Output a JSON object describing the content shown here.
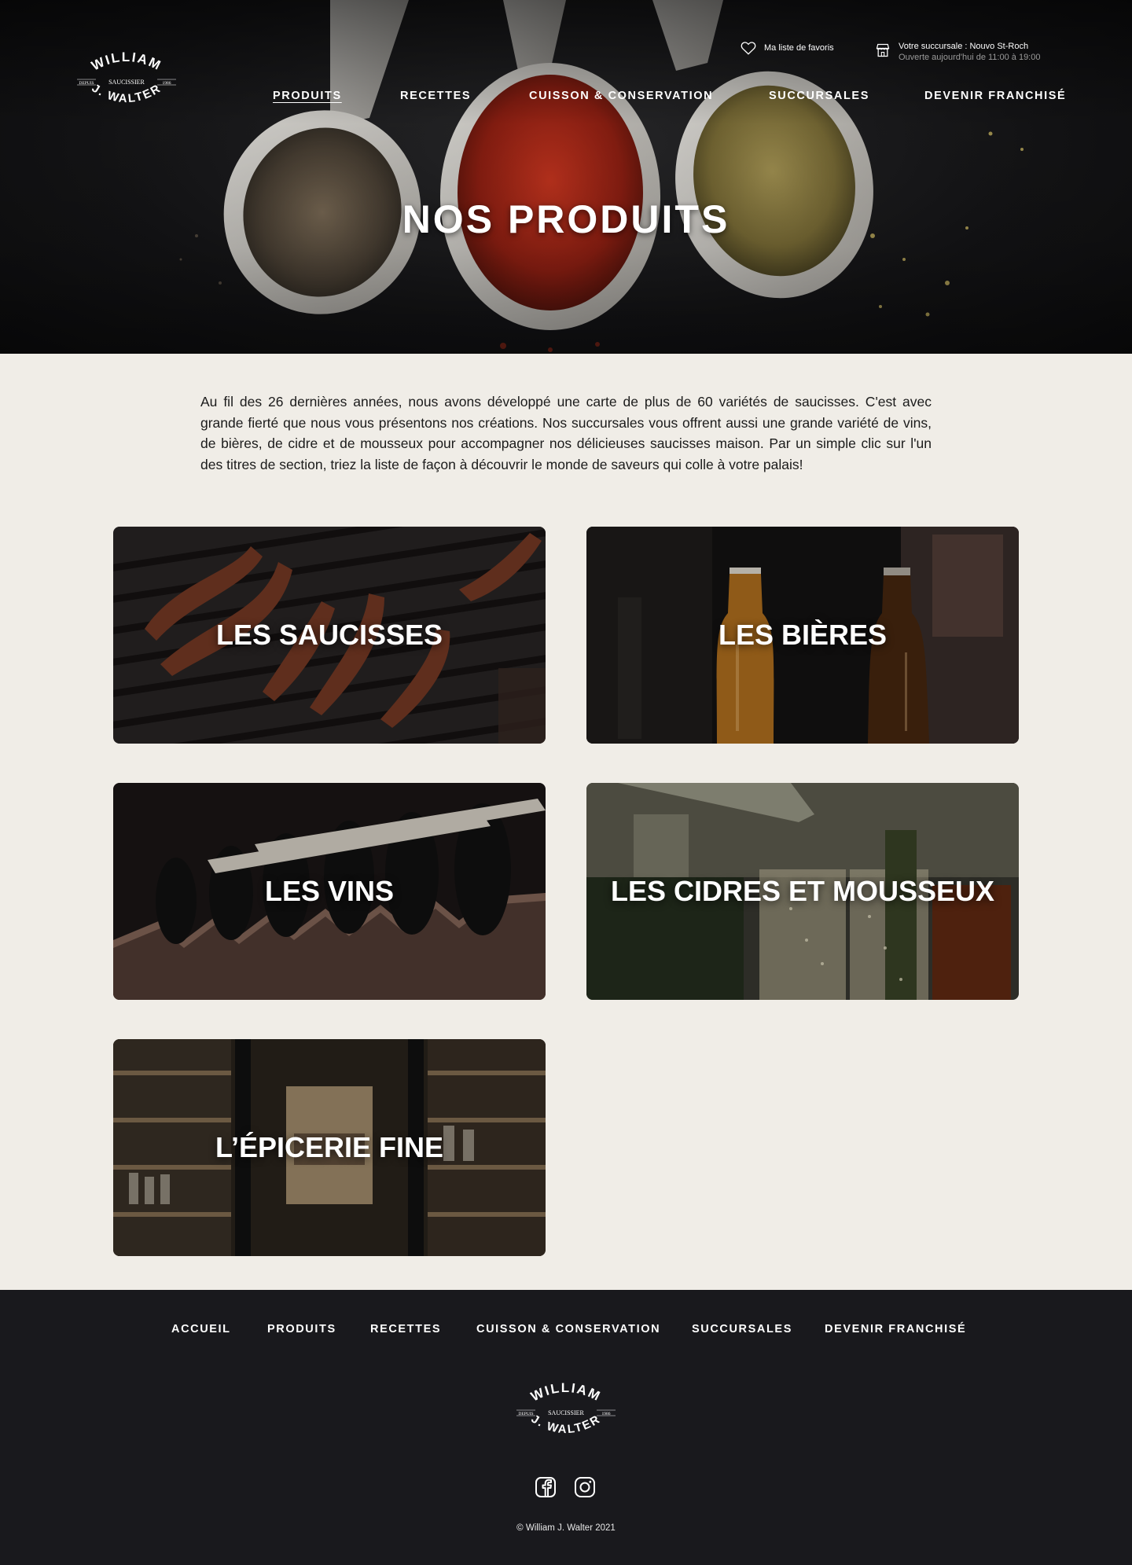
{
  "brand": {
    "top": "WILLIAM",
    "left": "DEPUIS",
    "middle": "SAUCISSIER",
    "right": "1986",
    "bottom": "J. WALTER"
  },
  "header": {
    "favorites_label": "Ma liste de favoris",
    "store_label": "Votre succursale : Nouvo St-Roch",
    "store_hours": "Ouverte aujourd'hui de 11:00 à 19:00"
  },
  "nav": {
    "items": [
      {
        "label": "PRODUITS",
        "active": true
      },
      {
        "label": "RECETTES",
        "active": false
      },
      {
        "label": "CUISSON & CONSERVATION",
        "active": false
      },
      {
        "label": "SUCCURSALES",
        "active": false
      },
      {
        "label": "DEVENIR FRANCHISÉ",
        "active": false
      }
    ]
  },
  "hero": {
    "title": "NOS PRODUITS"
  },
  "intro": {
    "text": "Au fil des 26 dernières années, nous avons développé une carte de plus de 60 variétés de saucisses. C'est avec grande fierté que nous vous présentons nos créations. Nos succursales vous offrent aussi une grande variété de vins, de bières, de cidre et de mousseux pour accompagner nos délicieuses saucisses maison. Par un simple clic sur l'un des titres de section, triez la liste de façon à découvrir le monde de saveurs qui colle à votre palais!"
  },
  "categories": [
    {
      "title": "LES SAUCISSES"
    },
    {
      "title": "LES BIÈRES"
    },
    {
      "title": "LES VINS"
    },
    {
      "title": "LES CIDRES ET MOUSSEUX"
    },
    {
      "title": "L’ÉPICERIE FINE"
    }
  ],
  "footer": {
    "nav": [
      "ACCUEIL",
      "PRODUITS",
      "RECETTES",
      "CUISSON & CONSERVATION",
      "SUCCURSALES",
      "DEVENIR FRANCHISÉ"
    ],
    "social_icons": [
      "facebook-icon",
      "instagram-icon"
    ],
    "copyright": "© William J. Walter 2021"
  },
  "colors": {
    "page_bg": "#f0ede7",
    "footer_bg": "#19191d",
    "text": "#1b1b1b",
    "white": "#ffffff"
  }
}
